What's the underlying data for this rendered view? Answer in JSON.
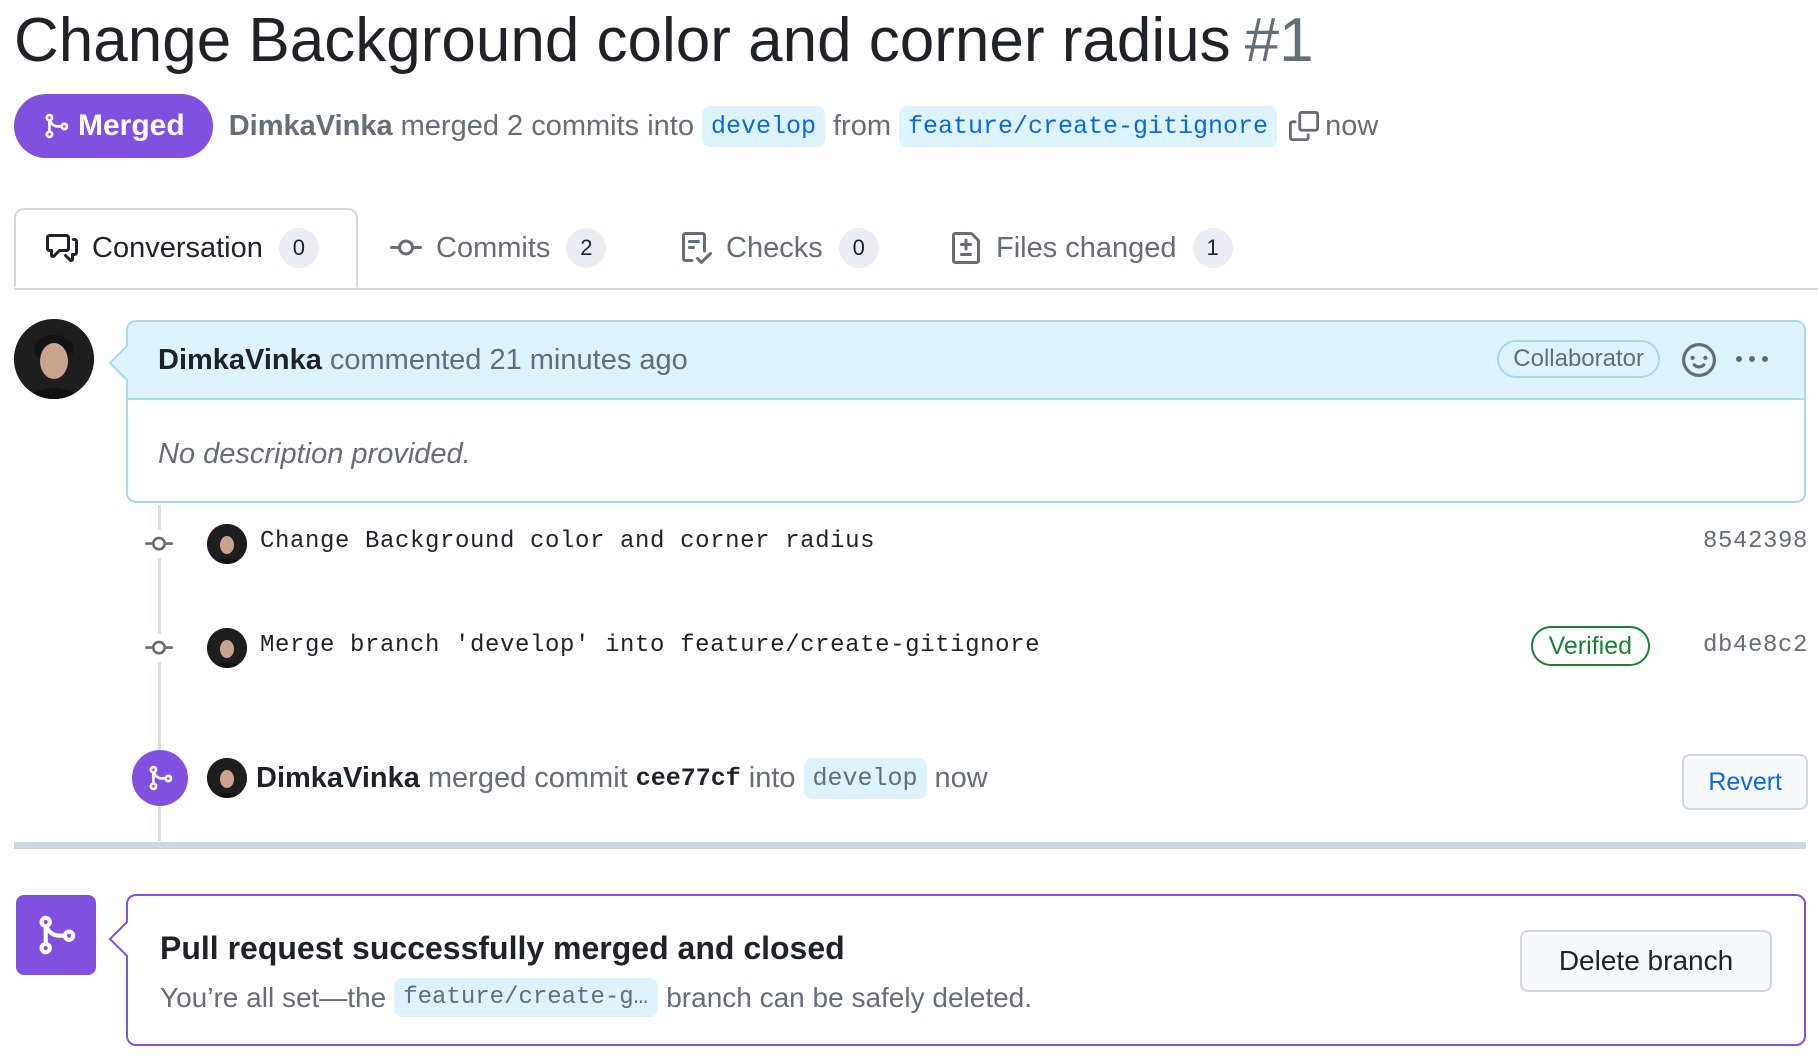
{
  "header": {
    "title": "Change Background color and corner radius",
    "number": "#1",
    "state": "Merged",
    "author": "DimkaVinka",
    "summary": "merged 2 commits into",
    "base_branch": "develop",
    "from": "from",
    "head_branch": "feature/create-gitignore",
    "time": "now"
  },
  "tabs": [
    {
      "label": "Conversation",
      "count": "0",
      "icon": "comment-discussion-icon",
      "selected": true
    },
    {
      "label": "Commits",
      "count": "2",
      "icon": "git-commit-icon",
      "selected": false
    },
    {
      "label": "Checks",
      "count": "0",
      "icon": "checklist-icon",
      "selected": false
    },
    {
      "label": "Files changed",
      "count": "1",
      "icon": "file-diff-icon",
      "selected": false
    }
  ],
  "comment": {
    "author": "DimkaVinka",
    "action": "commented 21 minutes ago",
    "role": "Collaborator",
    "body": "No description provided."
  },
  "commits": [
    {
      "message": "Change Background color and corner radius",
      "sha": "8542398",
      "verified": ""
    },
    {
      "message": "Merge branch 'develop' into feature/create-gitignore",
      "sha": "db4e8c2",
      "verified": "Verified"
    }
  ],
  "merge_event": {
    "author": "DimkaVinka",
    "action": "merged commit",
    "sha": "cee77cf",
    "into": "into",
    "branch": "develop",
    "time": "now",
    "revert_label": "Revert"
  },
  "merged_box": {
    "title": "Pull request successfully merged and closed",
    "sub_prefix": "You’re all set—the",
    "branch": "feature/create-gitignore",
    "sub_suffix": "branch can be safely deleted.",
    "delete_label": "Delete branch"
  },
  "colors": {
    "merged": "#8250df",
    "link": "#0969da",
    "verified": "#1a7f37",
    "comment_header_bg": "#ddf4ff"
  }
}
